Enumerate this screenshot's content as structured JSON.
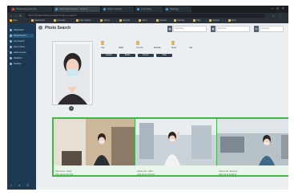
{
  "browser": {
    "tabs": [
      {
        "label": "Processing Service",
        "active": false,
        "dot": "#e85c3c"
      },
      {
        "label": "Face Recognition - Search",
        "active": true,
        "dot": "#4aa3df"
      },
      {
        "label": "Photo Search",
        "active": false,
        "dot": "#4aa3df"
      },
      {
        "label": "Live View",
        "active": false,
        "dot": "#4aa3df"
      },
      {
        "label": "Settings",
        "active": false,
        "dot": "#4aa3df"
      }
    ],
    "url": "https://localhost/facerecognition/photo-search",
    "bookmarks": [
      "Apps",
      "Dashboard",
      "Cameras",
      "Face Library",
      "Alarms",
      "Reports",
      "Users",
      "Devices",
      "Settings",
      "Help",
      "Support",
      "Docs"
    ]
  },
  "sidebar": {
    "items": [
      {
        "label": "Dashboard",
        "active": false
      },
      {
        "label": "Photo Search",
        "active": true
      },
      {
        "label": "Live Search",
        "active": false
      },
      {
        "label": "Face Library",
        "active": false
      },
      {
        "label": "Alarm Events",
        "active": false
      },
      {
        "label": "Statistics",
        "active": false
      },
      {
        "label": "Settings",
        "active": false
      }
    ]
  },
  "main": {
    "title": "Photo Search",
    "filters": [
      {
        "label": "Start time"
      },
      {
        "label": "End time"
      },
      {
        "label": "Similarity"
      }
    ],
    "attributes": [
      {
        "key": "Age",
        "value": "Adult"
      },
      {
        "key": "Gender",
        "value": "Female"
      },
      {
        "key": "Mask",
        "value": "Yes"
      }
    ],
    "actions": [
      "Search",
      "Reset",
      "Export",
      "Clear"
    ],
    "results": [
      {
        "caption": "Camera 01 - Lobby",
        "time": "2021-09-14 10:21:05"
      },
      {
        "caption": "Camera 02 - Office",
        "time": "2021-09-14 10:24:37"
      },
      {
        "caption": "Camera 03 - Entrance",
        "time": "2021-09-14 10:29:12"
      }
    ]
  },
  "colors": {
    "sidebar": "#1e3a53",
    "accent_green": "#3fb848",
    "accent_yellow": "#e2b651"
  }
}
